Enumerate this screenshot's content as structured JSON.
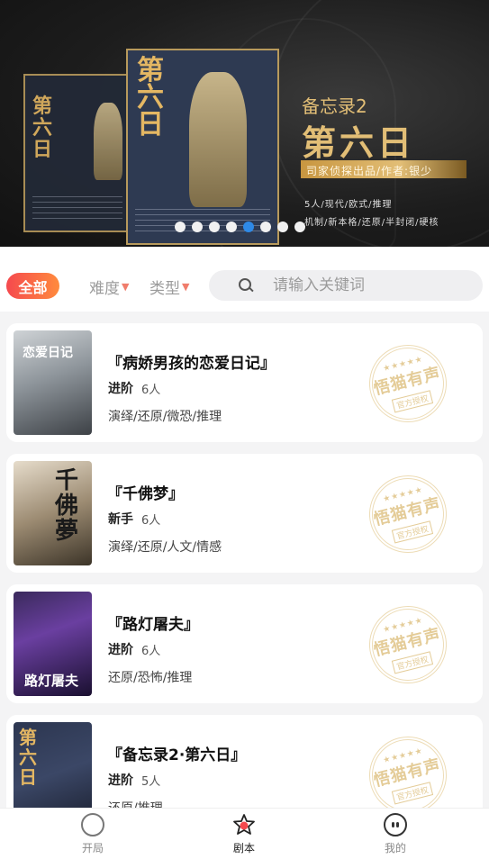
{
  "banner": {
    "subtitle": "备忘录2",
    "title": "第六日",
    "credit": "司家侦探出品/作者:银少",
    "tags_line1": "5人/现代/欧式/推理",
    "tags_line2": "机制/新本格/还原/半封闭/硬核",
    "poster_front_title": "第六日",
    "poster_back_title": "第六日",
    "dots_total": 8,
    "active_dot": 5
  },
  "filters": {
    "all_label": "全部",
    "difficulty_label": "难度",
    "type_label": "类型",
    "search_placeholder": "请输入关键词"
  },
  "scripts": [
    {
      "title": "『病娇男孩的恋爱日记』",
      "level": "进阶",
      "players": "6人",
      "tags": "演绎/还原/微恐/推理",
      "cover_text": "恋爱日记"
    },
    {
      "title": "『千佛梦』",
      "level": "新手",
      "players": "6人",
      "tags": "演绎/还原/人文/情感",
      "cover_text": "千佛夢"
    },
    {
      "title": "『路灯屠夫』",
      "level": "进阶",
      "players": "6人",
      "tags": "还原/恐怖/推理",
      "cover_text": "路灯屠夫"
    },
    {
      "title": "『备忘录2·第六日』",
      "level": "进阶",
      "players": "5人",
      "tags": "还原/推理",
      "cover_text": "第六日"
    }
  ],
  "stamp": {
    "main": "悟猫有声",
    "sub": "官方授权"
  },
  "nav": [
    {
      "label": "开局",
      "icon": "circle-icon"
    },
    {
      "label": "剧本",
      "icon": "script-badge-icon"
    },
    {
      "label": "我的",
      "icon": "face-icon"
    }
  ],
  "colors": {
    "accent_gradient_start": "#f5494e",
    "accent_gradient_end": "#ff8b3d",
    "active_dot": "#2e89e6",
    "banner_gold": "#e2be76",
    "stamp": "#e4cc98"
  }
}
